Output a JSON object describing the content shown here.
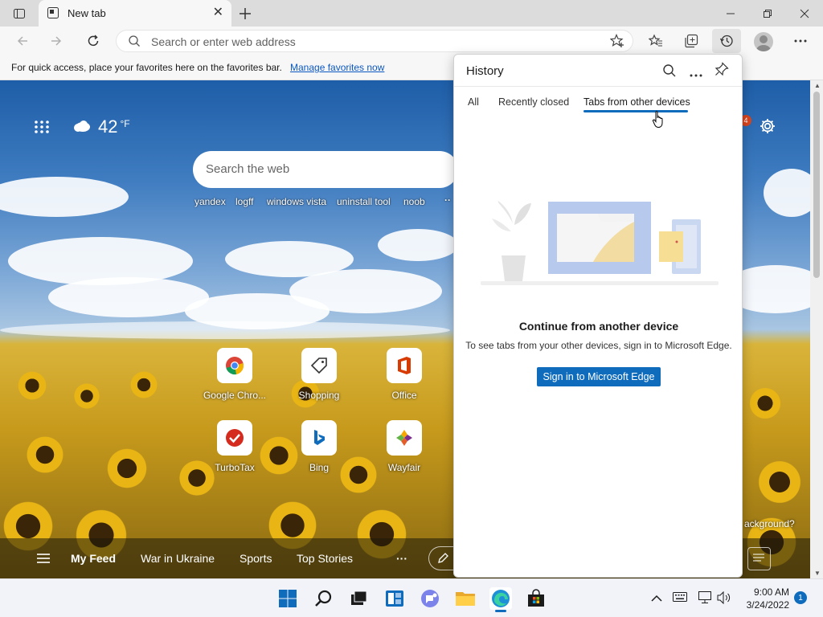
{
  "browser": {
    "tab_title": "New tab",
    "address_placeholder": "Search or enter web address",
    "favorites_bar_text": "For quick access, place your favorites here on the favorites bar.",
    "favorites_link": "Manage favorites now"
  },
  "newtab": {
    "weather_temp": "42",
    "weather_unit": "°F",
    "search_placeholder": "Search the web",
    "suggestions": [
      "yandex",
      "logff",
      "windows vista",
      "uninstall tool",
      "noob"
    ],
    "tiles": [
      {
        "label": "Google Chro...",
        "icon": "chrome-icon"
      },
      {
        "label": "Shopping",
        "icon": "shopping-tag-icon"
      },
      {
        "label": "Office",
        "icon": "office-icon"
      },
      {
        "label": "TurboTax",
        "icon": "turbotax-icon"
      },
      {
        "label": "Bing",
        "icon": "bing-icon"
      },
      {
        "label": "Wayfair",
        "icon": "wayfair-icon"
      }
    ],
    "feed_tabs": [
      "My Feed",
      "War in Ukraine",
      "Sports",
      "Top Stories"
    ],
    "notification_count": "4",
    "background_prompt": "ackground?"
  },
  "history_panel": {
    "title": "History",
    "tabs": [
      "All",
      "Recently closed",
      "Tabs from other devices"
    ],
    "active_tab": "Tabs from other devices",
    "empty_title": "Continue from another device",
    "empty_desc": "To see tabs from your other devices, sign in to Microsoft Edge.",
    "signin_button": "Sign in to Microsoft Edge"
  },
  "taskbar": {
    "time": "9:00 AM",
    "date": "3/24/2022",
    "notifications": "1"
  },
  "colors": {
    "accent": "#0f6cbd",
    "tab_strip": "#dcdcdc",
    "toolbar": "#f7f7f7"
  }
}
